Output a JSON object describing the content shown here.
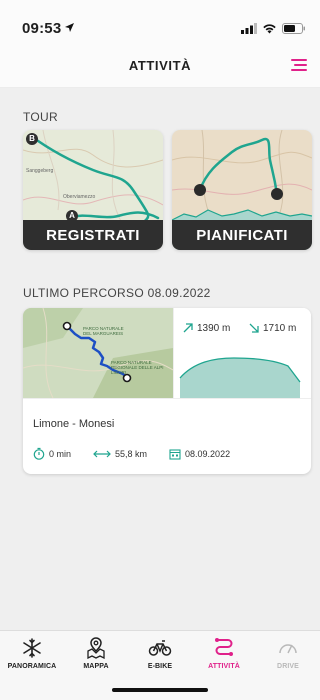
{
  "status_bar": {
    "time": "09:53"
  },
  "header": {
    "title": "ATTIVITÀ"
  },
  "tour": {
    "section_label": "TOUR",
    "cards": [
      {
        "label": "REGISTRATI",
        "map_labels": [
          "Sanggeberg",
          "Oberviamezzo"
        ],
        "markers": [
          "A",
          "B"
        ]
      },
      {
        "label": "PIANIFICATI"
      }
    ]
  },
  "recent": {
    "section_label": "ULTIMO PERCORSO 08.09.2022",
    "map_labels": [
      "PARCO NATURALE DEL MARGUAREIS",
      "PARCO NATURALE REGIONALE DELLE ALPI LIGURI"
    ],
    "ascent": "1390 m",
    "descent": "1710 m",
    "route_name": "Limone - Monesi",
    "duration": "0 min",
    "distance": "55,8 km",
    "date": "08.09.2022"
  },
  "tabs": [
    {
      "label": "PANORAMICA",
      "icon": "snowflake-icon",
      "active": false
    },
    {
      "label": "MAPPA",
      "icon": "map-pin-icon",
      "active": false
    },
    {
      "label": "E-BIKE",
      "icon": "bike-icon",
      "active": false
    },
    {
      "label": "ATTIVITÀ",
      "icon": "route-icon",
      "active": true
    },
    {
      "label": "DRIVE",
      "icon": "gauge-icon",
      "active": false,
      "disabled": true
    }
  ],
  "colors": {
    "accent": "#e0218a",
    "route": "#1fa58f",
    "recent_route": "#1d4fc4",
    "elevation_fill": "#a9d6cd",
    "disabled": "#b9b9b9"
  }
}
